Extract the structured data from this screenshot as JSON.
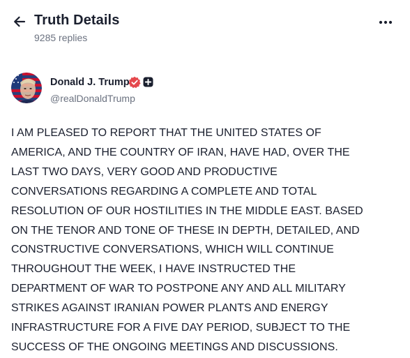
{
  "header": {
    "title": "Truth Details",
    "replies": "9285 replies",
    "back_icon": "arrow-left-icon",
    "more_icon": "ellipsis-icon"
  },
  "author": {
    "display_name": "Donald J. Trump",
    "handle": "@realDonaldTrump",
    "verified_icon": "verified-badge-icon",
    "verified_color": "#e5484d",
    "plus_icon": "plus-badge-icon"
  },
  "post": {
    "text": "I AM PLEASED TO REPORT THAT THE UNITED STATES OF\nAMERICA, AND THE COUNTRY OF IRAN, HAVE HAD, OVER THE\nLAST TWO DAYS, VERY GOOD AND PRODUCTIVE\nCONVERSATIONS REGARDING A COMPLETE AND TOTAL\nRESOLUTION OF OUR HOSTILITIES IN THE MIDDLE EAST. BASED\nON THE TENOR AND TONE OF THESE IN DEPTH, DETAILED, AND\nCONSTRUCTIVE CONVERSATIONS, WHICH WILL CONTINUE\nTHROUGHOUT THE WEEK, I HAVE INSTRUCTED THE\nDEPARTMENT OF WAR TO POSTPONE ANY AND ALL MILITARY\nSTRIKES AGAINST IRANIAN POWER PLANTS AND ENERGY\nINFRASTRUCTURE FOR A FIVE DAY PERIOD, SUBJECT TO THE\nSUCCESS OF THE ONGOING MEETINGS AND DISCUSSIONS."
  }
}
